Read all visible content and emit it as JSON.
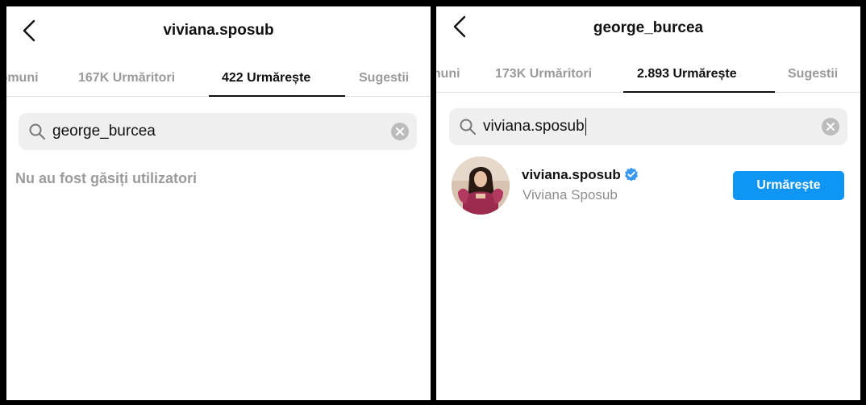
{
  "left": {
    "title": "viviana.sposub",
    "tabs": [
      {
        "label": "Comuni"
      },
      {
        "label": "167K Urmăritori"
      },
      {
        "label": "422 Urmărește"
      },
      {
        "label": "Sugestii"
      }
    ],
    "active_tab": 2,
    "search": {
      "value": "george_burcea"
    },
    "empty_message": "Nu au fost găsiți utilizatori"
  },
  "right": {
    "title": "george_burcea",
    "tabs": [
      {
        "label": "Comuni"
      },
      {
        "label": "173K Urmăritori"
      },
      {
        "label": "2.893 Urmărește"
      },
      {
        "label": "Sugestii"
      }
    ],
    "active_tab": 2,
    "search": {
      "value": "viviana.sposub"
    },
    "result": {
      "username": "viviana.sposub",
      "full_name": "Viviana Sposub",
      "verified": true,
      "follow_label": "Urmărește"
    }
  },
  "colors": {
    "accent": "#0f95f3",
    "verified": "#3897f0",
    "inactive_text": "#9a9a9a",
    "search_bg": "#efefef"
  },
  "icons": [
    "back-arrow-icon",
    "search-icon",
    "clear-icon",
    "verified-badge-icon"
  ]
}
